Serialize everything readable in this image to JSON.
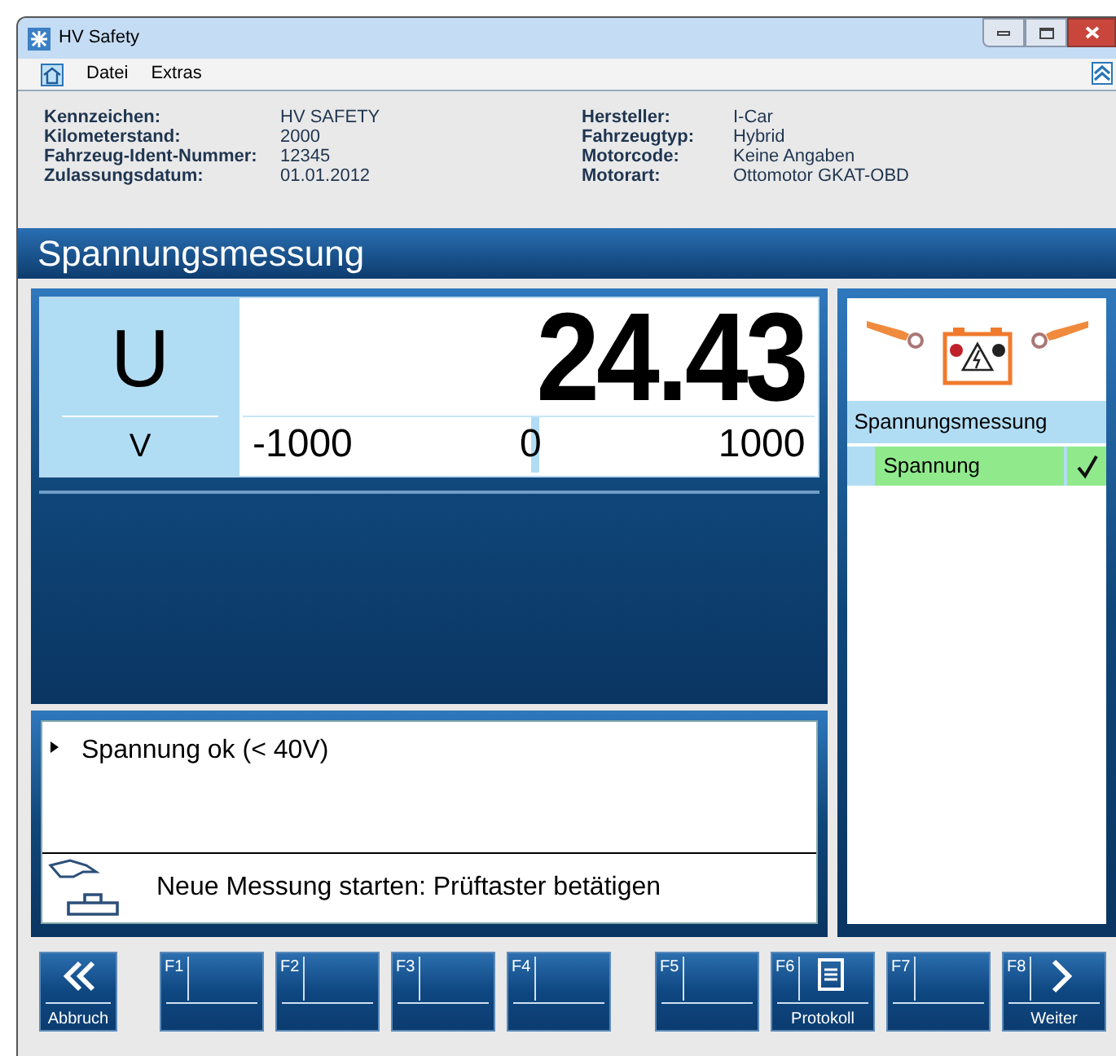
{
  "window": {
    "title": "HV Safety"
  },
  "menu": [
    "Datei",
    "Extras"
  ],
  "vehicle_left": [
    {
      "label": "Kennzeichen:",
      "value": "HV SAFETY"
    },
    {
      "label": "Kilometerstand:",
      "value": "2000"
    },
    {
      "label": "Fahrzeug-Ident-Nummer:",
      "value": "12345"
    },
    {
      "label": "Zulassungsdatum:",
      "value": "01.01.2012"
    }
  ],
  "vehicle_right": [
    {
      "label": "Hersteller:",
      "value": "I-Car"
    },
    {
      "label": "Fahrzeugtyp:",
      "value": "Hybrid"
    },
    {
      "label": "Motorcode:",
      "value": "Keine Angaben"
    },
    {
      "label": "Motorart:",
      "value": "Ottomotor GKAT-OBD"
    }
  ],
  "page_title": "Spannungsmessung",
  "meter": {
    "symbol": "U",
    "unit": "V",
    "value": "24.43",
    "scale_min": "-1000",
    "scale_mid": "0",
    "scale_max": "1000",
    "level": 0.51
  },
  "result": {
    "text": "Spannung ok (< 40V)",
    "instruction": "Neue Messung starten: Prüftaster betätigen"
  },
  "steps": {
    "title": "Spannungsmessung",
    "items": [
      {
        "label": "Spannung",
        "done": true,
        "selected": true
      }
    ]
  },
  "function_keys": [
    {
      "kind": "back",
      "label": "Abbruch"
    },
    {
      "kind": "blank",
      "key": "F1"
    },
    {
      "kind": "blank",
      "key": "F2"
    },
    {
      "kind": "blank",
      "key": "F3"
    },
    {
      "kind": "blank",
      "key": "F4"
    },
    {
      "kind": "blank",
      "key": "F5"
    },
    {
      "kind": "document",
      "key": "F6",
      "label": "Protokoll"
    },
    {
      "kind": "blank",
      "key": "F7"
    },
    {
      "kind": "next",
      "key": "F8",
      "label": "Weiter"
    }
  ]
}
